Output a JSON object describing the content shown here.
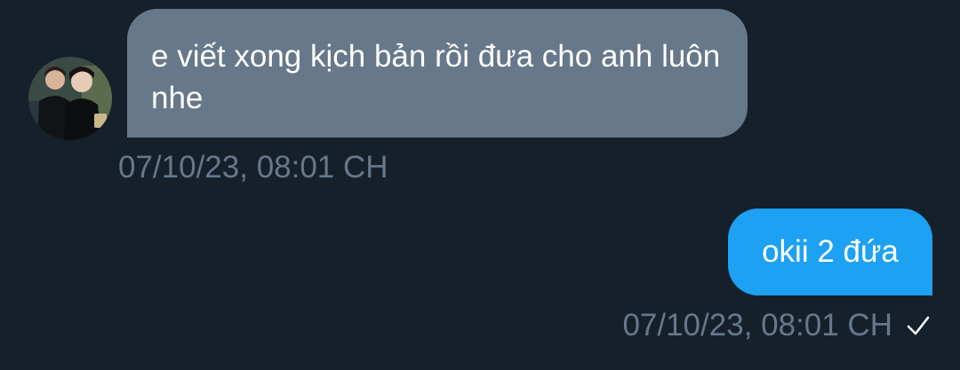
{
  "conversation": {
    "received": {
      "text": "e viết xong kịch bản rồi đưa cho anh luôn nhe",
      "timestamp": "07/10/23, 08:01 CH",
      "avatar_icon": "user-avatar-photo"
    },
    "sent": {
      "text": "okii 2 đứa",
      "timestamp": "07/10/23, 08:01 CH",
      "status_icon": "checkmark-icon"
    }
  },
  "colors": {
    "background": "#15202b",
    "received_bubble": "#66788a",
    "sent_bubble": "#1da1f2",
    "timestamp": "#66788a",
    "text": "#ffffff"
  }
}
